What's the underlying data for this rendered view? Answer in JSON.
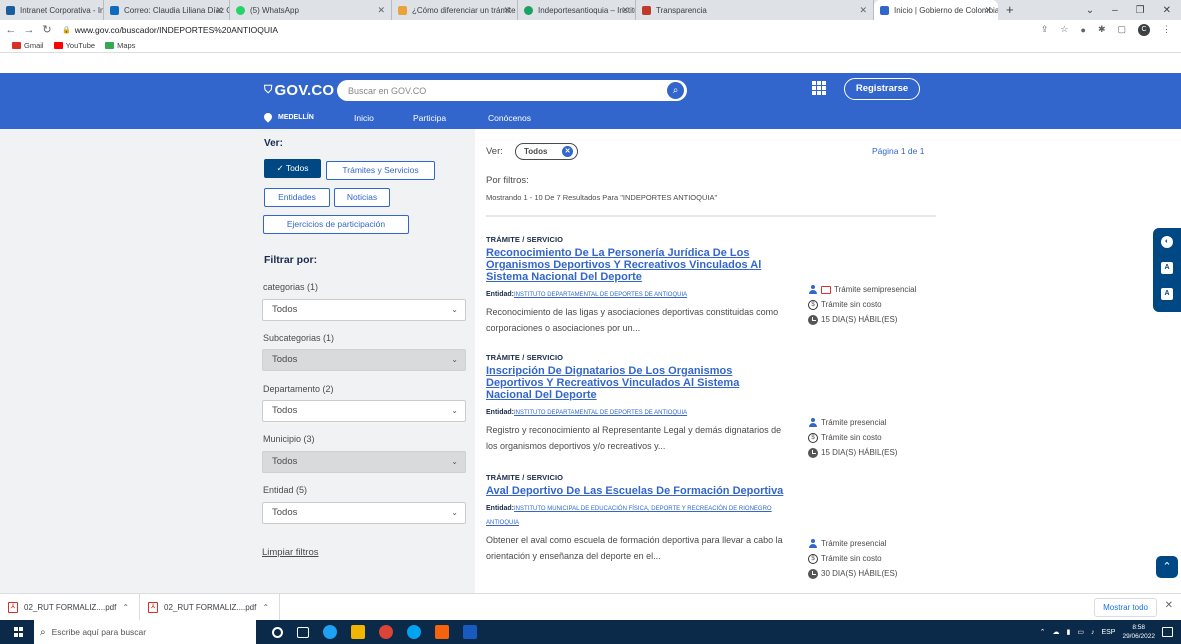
{
  "browser": {
    "tabs": [
      {
        "label": "Intranet Corporativa - Inicio",
        "color": "#1b5e9e"
      },
      {
        "label": "Correo: Claudia Liliana Díaz Osc",
        "color": "#0f6cbd"
      },
      {
        "label": "(5) WhatsApp",
        "color": "#25d366"
      },
      {
        "label": "¿Cómo diferenciar un trámite de",
        "color": "#e8a33c"
      },
      {
        "label": "Indeportesantioquia – Instituto",
        "color": "#1aa260"
      },
      {
        "label": "Transparencia",
        "color": "#c0392b"
      },
      {
        "label": "Inicio | Gobierno de Colombia",
        "color": "#3366cc"
      }
    ],
    "new_tab": "+",
    "url": "www.gov.co/buscador/INDEPORTES%20ANTIOQUIA",
    "profile_initial": "C",
    "bookmarks": [
      {
        "label": "Gmail",
        "color": "#d93025"
      },
      {
        "label": "YouTube",
        "color": "#ff0000"
      },
      {
        "label": "Maps",
        "color": "#34a853"
      }
    ]
  },
  "header": {
    "logo": "GOV.CO",
    "search_placeholder": "Buscar en GOV.CO",
    "register_label": "Registrarse",
    "location": "MEDELLÍN",
    "nav": [
      "Inicio",
      "Participa",
      "Conócenos"
    ]
  },
  "sidebar": {
    "ver_title": "Ver:",
    "chips": [
      "✓ Todos",
      "Trámites y Servicios",
      "Entidades",
      "Noticias",
      "Ejercicios de participación"
    ],
    "filter_title": "Filtrar por:",
    "filters": [
      {
        "label": "categorias (1)",
        "value": "Todos",
        "disabled": false
      },
      {
        "label": "Subcategorias (1)",
        "value": "Todos",
        "disabled": true
      },
      {
        "label": "Departamento (2)",
        "value": "Todos",
        "disabled": false
      },
      {
        "label": "Municipio (3)",
        "value": "Todos",
        "disabled": true
      },
      {
        "label": "Entidad (5)",
        "value": "Todos",
        "disabled": false
      }
    ],
    "clear_label": "Limpiar filtros"
  },
  "results": {
    "ver_label": "Ver:",
    "active_filter": "Todos",
    "page_info": "Página 1 de 1",
    "by_filters": "Por filtros:",
    "summary": "Mostrando 1 - 10 De 7 Resultados Para \"INDEPORTES ANTIOQUIA\"",
    "entity_prefix": "Entidad:",
    "items": [
      {
        "type": "TRÁMITE / SERVICIO",
        "title": "Reconocimiento De La Personería Jurídica De Los Organismos Deportivos Y Recreativos Vinculados Al Sistema Nacional Del Deporte",
        "entity": "INSTITUTO DEPARTAMENTAL DE DEPORTES DE ANTIOQUIA",
        "description": "Reconocimiento de las ligas y asociaciones deportivas constituidas como corporaciones o asociaciones por un...",
        "modality": "Trámite semipresencial",
        "cost": "Trámite sin costo",
        "time": "15 DIA(S) HÁBIL(ES)"
      },
      {
        "type": "TRÁMITE / SERVICIO",
        "title": "Inscripción De Dignatarios De Los Organismos Deportivos Y Recreativos Vinculados Al Sistema Nacional Del Deporte",
        "entity": "INSTITUTO DEPARTAMENTAL DE DEPORTES DE ANTIOQUIA",
        "description": "Registro y reconocimiento al Representante Legal y demás dignatarios de los organismos deportivos y/o recreativos y...",
        "modality": "Trámite presencial",
        "cost": "Trámite sin costo",
        "time": "15 DIA(S) HÁBIL(ES)"
      },
      {
        "type": "TRÁMITE / SERVICIO",
        "title": "Aval Deportivo De Las Escuelas De Formación Deportiva",
        "entity": "INSTITUTO MUNICIPAL DE EDUCACIÓN FÍSICA, DEPORTE Y RECREACIÓN DE RIONEGRO ANTIOQUIA",
        "description": "Obtener el aval como escuela de formación deportiva para llevar a cabo la orientación y enseñanza del deporte en el...",
        "modality": "Trámite presencial",
        "cost": "Trámite sin costo",
        "time": "30 DIA(S) HÁBIL(ES)"
      }
    ]
  },
  "downloads": {
    "items": [
      "02_RUT FORMALIZ....pdf",
      "02_RUT FORMALIZ....pdf"
    ],
    "show_all": "Mostrar todo"
  },
  "taskbar": {
    "search_placeholder": "Escribe aquí para buscar",
    "language": "ESP",
    "time": "8:58",
    "date": "29/06/2022"
  }
}
